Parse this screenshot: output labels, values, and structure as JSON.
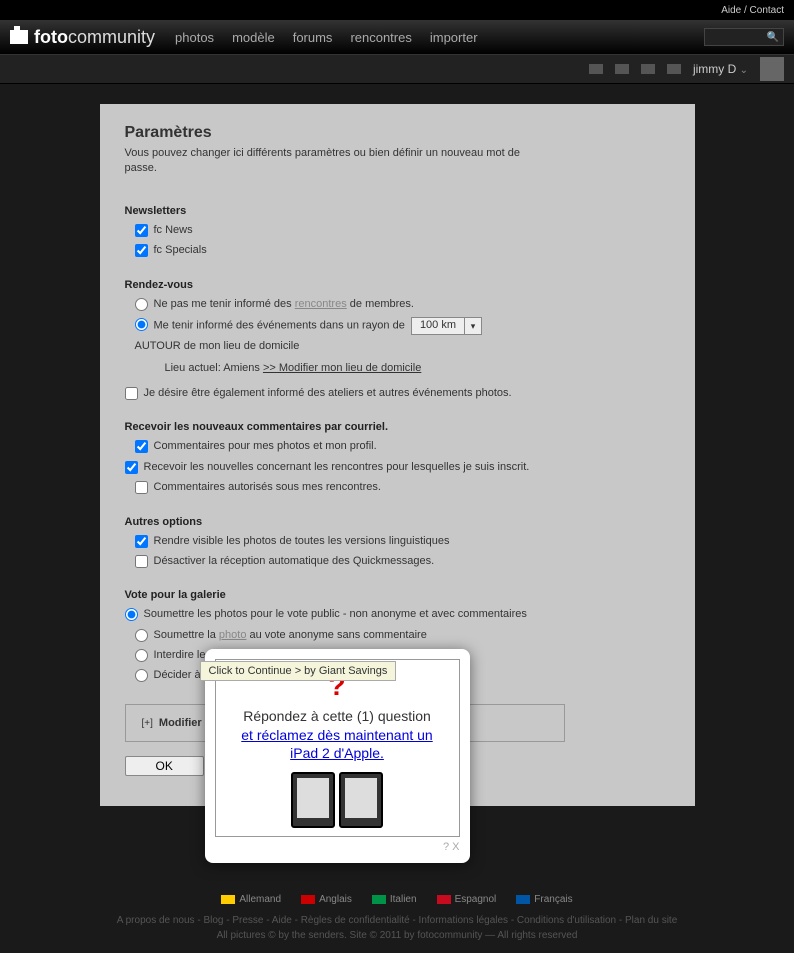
{
  "topbar": {
    "help": "Aide / Contact"
  },
  "logo": {
    "bold": "foto",
    "light": "community"
  },
  "nav": [
    "photos",
    "modèle",
    "forums",
    "rencontres",
    "importer"
  ],
  "user": {
    "name": "jimmy D"
  },
  "page": {
    "title": "Paramètres",
    "subtitle": "Vous pouvez changer ici différents paramètres ou bien définir un nouveau mot de passe."
  },
  "newsletters": {
    "heading": "Newsletters",
    "items": [
      {
        "label": "fc News",
        "checked": true
      },
      {
        "label": "fc Specials",
        "checked": true
      }
    ]
  },
  "rdv": {
    "heading": "Rendez-vous",
    "opt1_pre": "Ne pas me tenir informé des ",
    "opt1_link": "rencontres",
    "opt1_post": " de membres.",
    "opt2_pre": "Me tenir informé des événements dans un rayon de ",
    "distance": "100 km",
    "opt2_post": "AUTOUR de mon lieu de domicile",
    "loc_pre": "Lieu actuel: Amiens  ",
    "loc_link": ">> Modifier mon lieu de domicile",
    "opt3": "Je désire être également informé des ateliers et autres événements photos."
  },
  "comments": {
    "heading": "Recevoir les nouveaux commentaires par courriel.",
    "items": [
      {
        "label": "Commentaires pour mes photos et mon profil.",
        "checked": true
      },
      {
        "label": "Recevoir les nouvelles concernant les rencontres pour lesquelles je suis inscrit.",
        "checked": true
      },
      {
        "label": "Commentaires autorisés sous mes rencontres.",
        "checked": false
      }
    ]
  },
  "other": {
    "heading": "Autres options",
    "items": [
      {
        "label": "Rendre visible les photos de toutes les versions linguistiques",
        "checked": true
      },
      {
        "label": "Désactiver la réception automatique des Quickmessages.",
        "checked": false
      }
    ]
  },
  "vote": {
    "heading": "Vote pour la galerie",
    "opt1": "Soumettre les photos pour le vote public - non anonyme et avec commentaires",
    "opt2_pre": "Soumettre la ",
    "opt2_link": "photo",
    "opt2_post": " au vote anonyme sans commentaire",
    "opt3": "Interdire les v",
    "opt4": "Décider à cha"
  },
  "modifier": {
    "label": "Modifier l'"
  },
  "ok": "OK",
  "popup": {
    "tooltip": "Click to Continue > by Giant Savings",
    "q": "Répondez à cette (1) question",
    "claim": "et réclamez dès maintenant un iPad 2 d'Apple.",
    "close": "? X"
  },
  "footer": {
    "langs": [
      "Allemand",
      "Anglais",
      "Italien",
      "Espagnol",
      "Français"
    ],
    "flag_colors": [
      "#ffcc00",
      "#cc0000",
      "#009246",
      "#c60b1e",
      "#0055a4"
    ],
    "links": "A propos de nous - Blog - Presse - Aide - Règles de confidentialité - Informations légales - Conditions d'utilisation - Plan du site",
    "copyright": "All pictures © by the senders. Site © 2011 by fotocommunity — All rights reserved"
  }
}
